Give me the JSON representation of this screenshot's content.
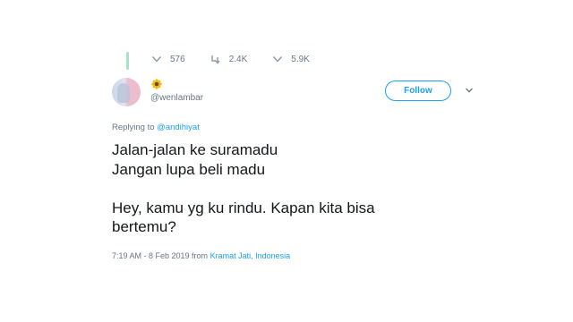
{
  "actions": {
    "reply_count": "576",
    "retweet_count": "2.4K",
    "like_count": "5.9K"
  },
  "user": {
    "display_emoji": "🌻",
    "handle": "@wenlambar"
  },
  "follow_button": {
    "label": "Follow"
  },
  "reply_context": {
    "prefix": "Replying to ",
    "mention": "@andihiyat"
  },
  "tweet": {
    "text": "Jalan-jalan ke suramadu\nJangan lupa beli madu\n\nHey, kamu yg ku rindu. Kapan kita bisa\nbertemu?"
  },
  "meta": {
    "timestamp": "7:19 AM - 8 Feb 2019 from ",
    "location": "Kramat Jati, Indonesia"
  },
  "icons": {
    "reply": "reply-icon",
    "retweet": "retweet-icon",
    "like": "heart-icon",
    "caret": "chevron-down-icon"
  },
  "colors": {
    "accent": "#1da1f2",
    "thread_line": "#a7e3c6",
    "muted": "#657786"
  }
}
